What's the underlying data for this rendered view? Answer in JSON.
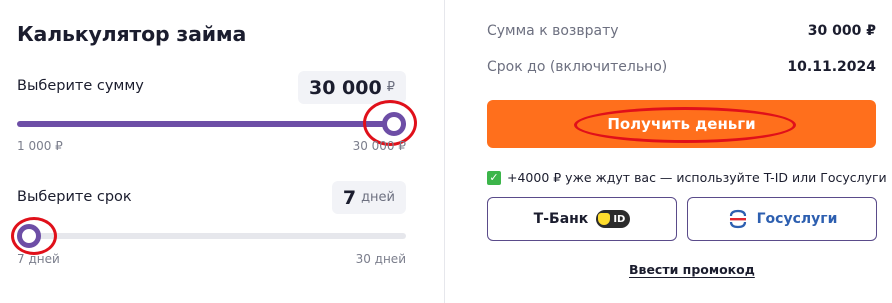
{
  "calculator": {
    "title": "Калькулятор займа",
    "amount": {
      "label": "Выберите сумму",
      "value": "30 000",
      "unit": "₽",
      "min_label": "1 000 ₽",
      "max_label": "30 000 ₽",
      "slider_fraction": 1.0
    },
    "term": {
      "label": "Выберите срок",
      "value": "7",
      "unit": "дней",
      "min_label": "7 дней",
      "max_label": "30 дней",
      "slider_fraction": 0.0
    }
  },
  "summary": {
    "repay_label": "Сумма к возврату",
    "repay_value": "30 000 ₽",
    "due_label": "Срок до (включительно)",
    "due_value": "10.11.2024"
  },
  "cta": {
    "label": "Получить деньги"
  },
  "notice": {
    "text": "+4000 ₽ уже ждут вас — используйте T-ID или Госуслуги"
  },
  "auth": {
    "tbank_label": "Т-Банк",
    "tbank_badge": "ID",
    "gosuslugi_label": "Госуслуги"
  },
  "promo": {
    "label": "Ввести промокод"
  },
  "colors": {
    "accent": "#6d4ea6",
    "cta": "#ff6f1c",
    "annotation": "#e0101a",
    "check": "#3cb54a"
  }
}
